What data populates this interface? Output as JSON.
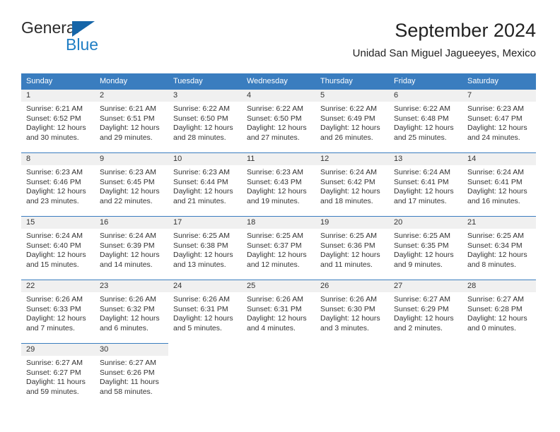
{
  "brand": {
    "name_top": "General",
    "name_bottom": "Blue",
    "accent_color": "#1f7ec4",
    "triangle_color": "#1565a8"
  },
  "header": {
    "title": "September 2024",
    "subtitle": "Unidad San Miguel Jagueeyes, Mexico",
    "header_bg": "#3a7dbf",
    "daynum_bg": "#f0f0f0"
  },
  "weekdays": [
    "Sunday",
    "Monday",
    "Tuesday",
    "Wednesday",
    "Thursday",
    "Friday",
    "Saturday"
  ],
  "weeks": [
    [
      {
        "day": "1",
        "sunrise": "Sunrise: 6:21 AM",
        "sunset": "Sunset: 6:52 PM",
        "daylight1": "Daylight: 12 hours",
        "daylight2": "and 30 minutes."
      },
      {
        "day": "2",
        "sunrise": "Sunrise: 6:21 AM",
        "sunset": "Sunset: 6:51 PM",
        "daylight1": "Daylight: 12 hours",
        "daylight2": "and 29 minutes."
      },
      {
        "day": "3",
        "sunrise": "Sunrise: 6:22 AM",
        "sunset": "Sunset: 6:50 PM",
        "daylight1": "Daylight: 12 hours",
        "daylight2": "and 28 minutes."
      },
      {
        "day": "4",
        "sunrise": "Sunrise: 6:22 AM",
        "sunset": "Sunset: 6:50 PM",
        "daylight1": "Daylight: 12 hours",
        "daylight2": "and 27 minutes."
      },
      {
        "day": "5",
        "sunrise": "Sunrise: 6:22 AM",
        "sunset": "Sunset: 6:49 PM",
        "daylight1": "Daylight: 12 hours",
        "daylight2": "and 26 minutes."
      },
      {
        "day": "6",
        "sunrise": "Sunrise: 6:22 AM",
        "sunset": "Sunset: 6:48 PM",
        "daylight1": "Daylight: 12 hours",
        "daylight2": "and 25 minutes."
      },
      {
        "day": "7",
        "sunrise": "Sunrise: 6:23 AM",
        "sunset": "Sunset: 6:47 PM",
        "daylight1": "Daylight: 12 hours",
        "daylight2": "and 24 minutes."
      }
    ],
    [
      {
        "day": "8",
        "sunrise": "Sunrise: 6:23 AM",
        "sunset": "Sunset: 6:46 PM",
        "daylight1": "Daylight: 12 hours",
        "daylight2": "and 23 minutes."
      },
      {
        "day": "9",
        "sunrise": "Sunrise: 6:23 AM",
        "sunset": "Sunset: 6:45 PM",
        "daylight1": "Daylight: 12 hours",
        "daylight2": "and 22 minutes."
      },
      {
        "day": "10",
        "sunrise": "Sunrise: 6:23 AM",
        "sunset": "Sunset: 6:44 PM",
        "daylight1": "Daylight: 12 hours",
        "daylight2": "and 21 minutes."
      },
      {
        "day": "11",
        "sunrise": "Sunrise: 6:23 AM",
        "sunset": "Sunset: 6:43 PM",
        "daylight1": "Daylight: 12 hours",
        "daylight2": "and 19 minutes."
      },
      {
        "day": "12",
        "sunrise": "Sunrise: 6:24 AM",
        "sunset": "Sunset: 6:42 PM",
        "daylight1": "Daylight: 12 hours",
        "daylight2": "and 18 minutes."
      },
      {
        "day": "13",
        "sunrise": "Sunrise: 6:24 AM",
        "sunset": "Sunset: 6:41 PM",
        "daylight1": "Daylight: 12 hours",
        "daylight2": "and 17 minutes."
      },
      {
        "day": "14",
        "sunrise": "Sunrise: 6:24 AM",
        "sunset": "Sunset: 6:41 PM",
        "daylight1": "Daylight: 12 hours",
        "daylight2": "and 16 minutes."
      }
    ],
    [
      {
        "day": "15",
        "sunrise": "Sunrise: 6:24 AM",
        "sunset": "Sunset: 6:40 PM",
        "daylight1": "Daylight: 12 hours",
        "daylight2": "and 15 minutes."
      },
      {
        "day": "16",
        "sunrise": "Sunrise: 6:24 AM",
        "sunset": "Sunset: 6:39 PM",
        "daylight1": "Daylight: 12 hours",
        "daylight2": "and 14 minutes."
      },
      {
        "day": "17",
        "sunrise": "Sunrise: 6:25 AM",
        "sunset": "Sunset: 6:38 PM",
        "daylight1": "Daylight: 12 hours",
        "daylight2": "and 13 minutes."
      },
      {
        "day": "18",
        "sunrise": "Sunrise: 6:25 AM",
        "sunset": "Sunset: 6:37 PM",
        "daylight1": "Daylight: 12 hours",
        "daylight2": "and 12 minutes."
      },
      {
        "day": "19",
        "sunrise": "Sunrise: 6:25 AM",
        "sunset": "Sunset: 6:36 PM",
        "daylight1": "Daylight: 12 hours",
        "daylight2": "and 11 minutes."
      },
      {
        "day": "20",
        "sunrise": "Sunrise: 6:25 AM",
        "sunset": "Sunset: 6:35 PM",
        "daylight1": "Daylight: 12 hours",
        "daylight2": "and 9 minutes."
      },
      {
        "day": "21",
        "sunrise": "Sunrise: 6:25 AM",
        "sunset": "Sunset: 6:34 PM",
        "daylight1": "Daylight: 12 hours",
        "daylight2": "and 8 minutes."
      }
    ],
    [
      {
        "day": "22",
        "sunrise": "Sunrise: 6:26 AM",
        "sunset": "Sunset: 6:33 PM",
        "daylight1": "Daylight: 12 hours",
        "daylight2": "and 7 minutes."
      },
      {
        "day": "23",
        "sunrise": "Sunrise: 6:26 AM",
        "sunset": "Sunset: 6:32 PM",
        "daylight1": "Daylight: 12 hours",
        "daylight2": "and 6 minutes."
      },
      {
        "day": "24",
        "sunrise": "Sunrise: 6:26 AM",
        "sunset": "Sunset: 6:31 PM",
        "daylight1": "Daylight: 12 hours",
        "daylight2": "and 5 minutes."
      },
      {
        "day": "25",
        "sunrise": "Sunrise: 6:26 AM",
        "sunset": "Sunset: 6:31 PM",
        "daylight1": "Daylight: 12 hours",
        "daylight2": "and 4 minutes."
      },
      {
        "day": "26",
        "sunrise": "Sunrise: 6:26 AM",
        "sunset": "Sunset: 6:30 PM",
        "daylight1": "Daylight: 12 hours",
        "daylight2": "and 3 minutes."
      },
      {
        "day": "27",
        "sunrise": "Sunrise: 6:27 AM",
        "sunset": "Sunset: 6:29 PM",
        "daylight1": "Daylight: 12 hours",
        "daylight2": "and 2 minutes."
      },
      {
        "day": "28",
        "sunrise": "Sunrise: 6:27 AM",
        "sunset": "Sunset: 6:28 PM",
        "daylight1": "Daylight: 12 hours",
        "daylight2": "and 0 minutes."
      }
    ],
    [
      {
        "day": "29",
        "sunrise": "Sunrise: 6:27 AM",
        "sunset": "Sunset: 6:27 PM",
        "daylight1": "Daylight: 11 hours",
        "daylight2": "and 59 minutes."
      },
      {
        "day": "30",
        "sunrise": "Sunrise: 6:27 AM",
        "sunset": "Sunset: 6:26 PM",
        "daylight1": "Daylight: 11 hours",
        "daylight2": "and 58 minutes."
      },
      {
        "day": "",
        "sunrise": "",
        "sunset": "",
        "daylight1": "",
        "daylight2": ""
      },
      {
        "day": "",
        "sunrise": "",
        "sunset": "",
        "daylight1": "",
        "daylight2": ""
      },
      {
        "day": "",
        "sunrise": "",
        "sunset": "",
        "daylight1": "",
        "daylight2": ""
      },
      {
        "day": "",
        "sunrise": "",
        "sunset": "",
        "daylight1": "",
        "daylight2": ""
      },
      {
        "day": "",
        "sunrise": "",
        "sunset": "",
        "daylight1": "",
        "daylight2": ""
      }
    ]
  ]
}
